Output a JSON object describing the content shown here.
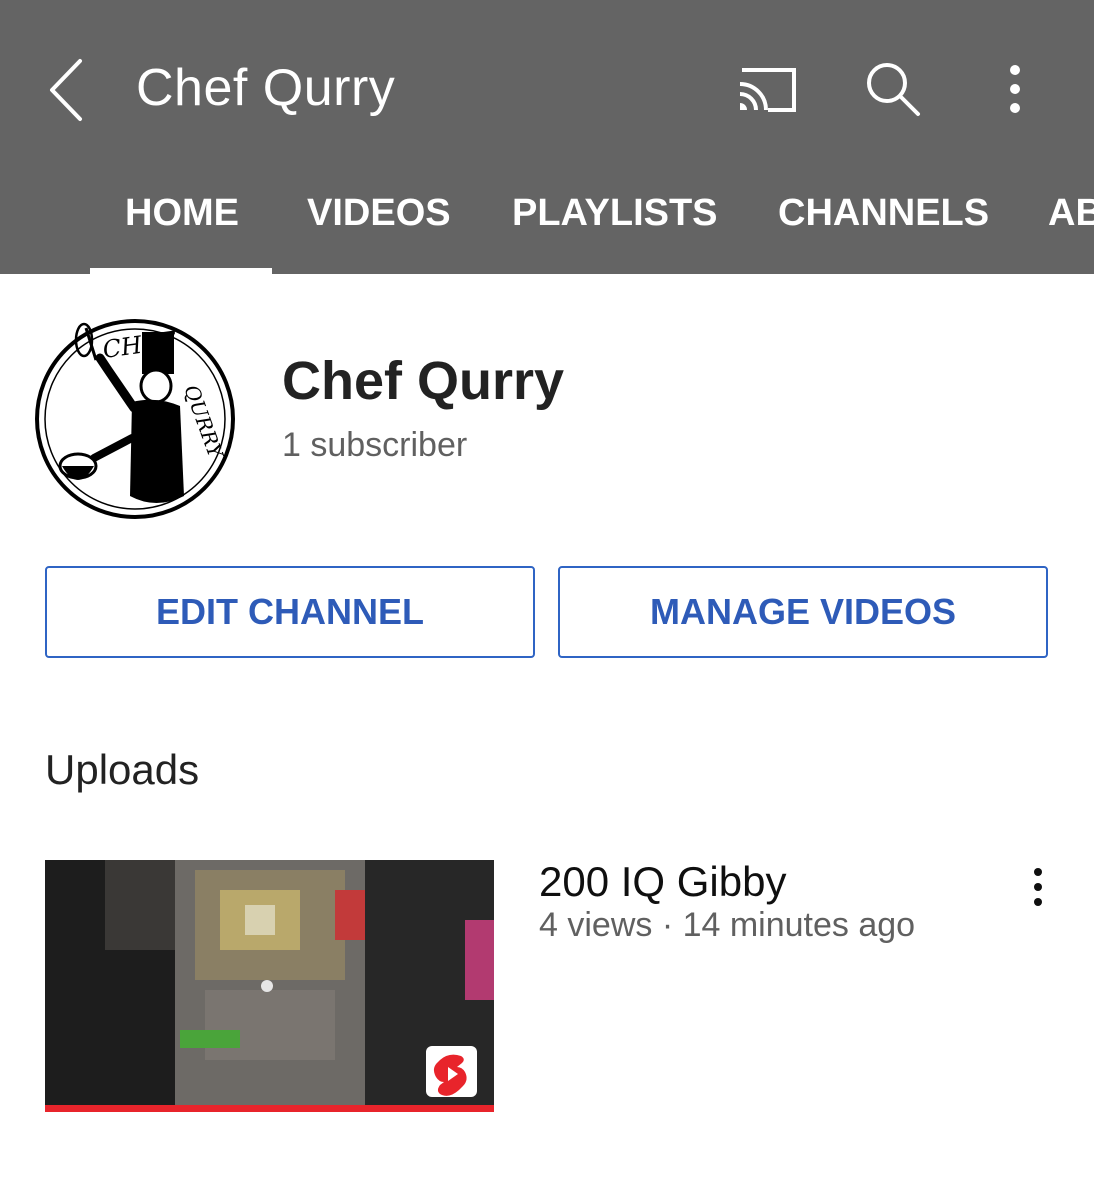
{
  "header": {
    "title": "Chef Qurry",
    "back_icon": "back-arrow-icon",
    "cast_icon": "cast-icon",
    "search_icon": "search-icon",
    "more_icon": "more-vert-icon",
    "background_color": "#646464"
  },
  "tabs": [
    {
      "label": "HOME",
      "active": true
    },
    {
      "label": "VIDEOS",
      "active": false
    },
    {
      "label": "PLAYLISTS",
      "active": false
    },
    {
      "label": "CHANNELS",
      "active": false
    },
    {
      "label": "AB",
      "active": false
    }
  ],
  "channel": {
    "name": "Chef Qurry",
    "subscribers": "1 subscriber",
    "avatar_logo_text": "CHEF QURRY"
  },
  "buttons": {
    "edit_channel": "EDIT CHANNEL",
    "manage_videos": "MANAGE VIDEOS",
    "accent_color": "#2e5bb8"
  },
  "uploads": {
    "section_title": "Uploads",
    "videos": [
      {
        "title": "200 IQ Gibby",
        "meta": "4 views · 14 minutes ago",
        "shorts_icon": "shorts-icon",
        "watched_progress": 1.0,
        "progress_color": "#e8242b"
      }
    ]
  }
}
